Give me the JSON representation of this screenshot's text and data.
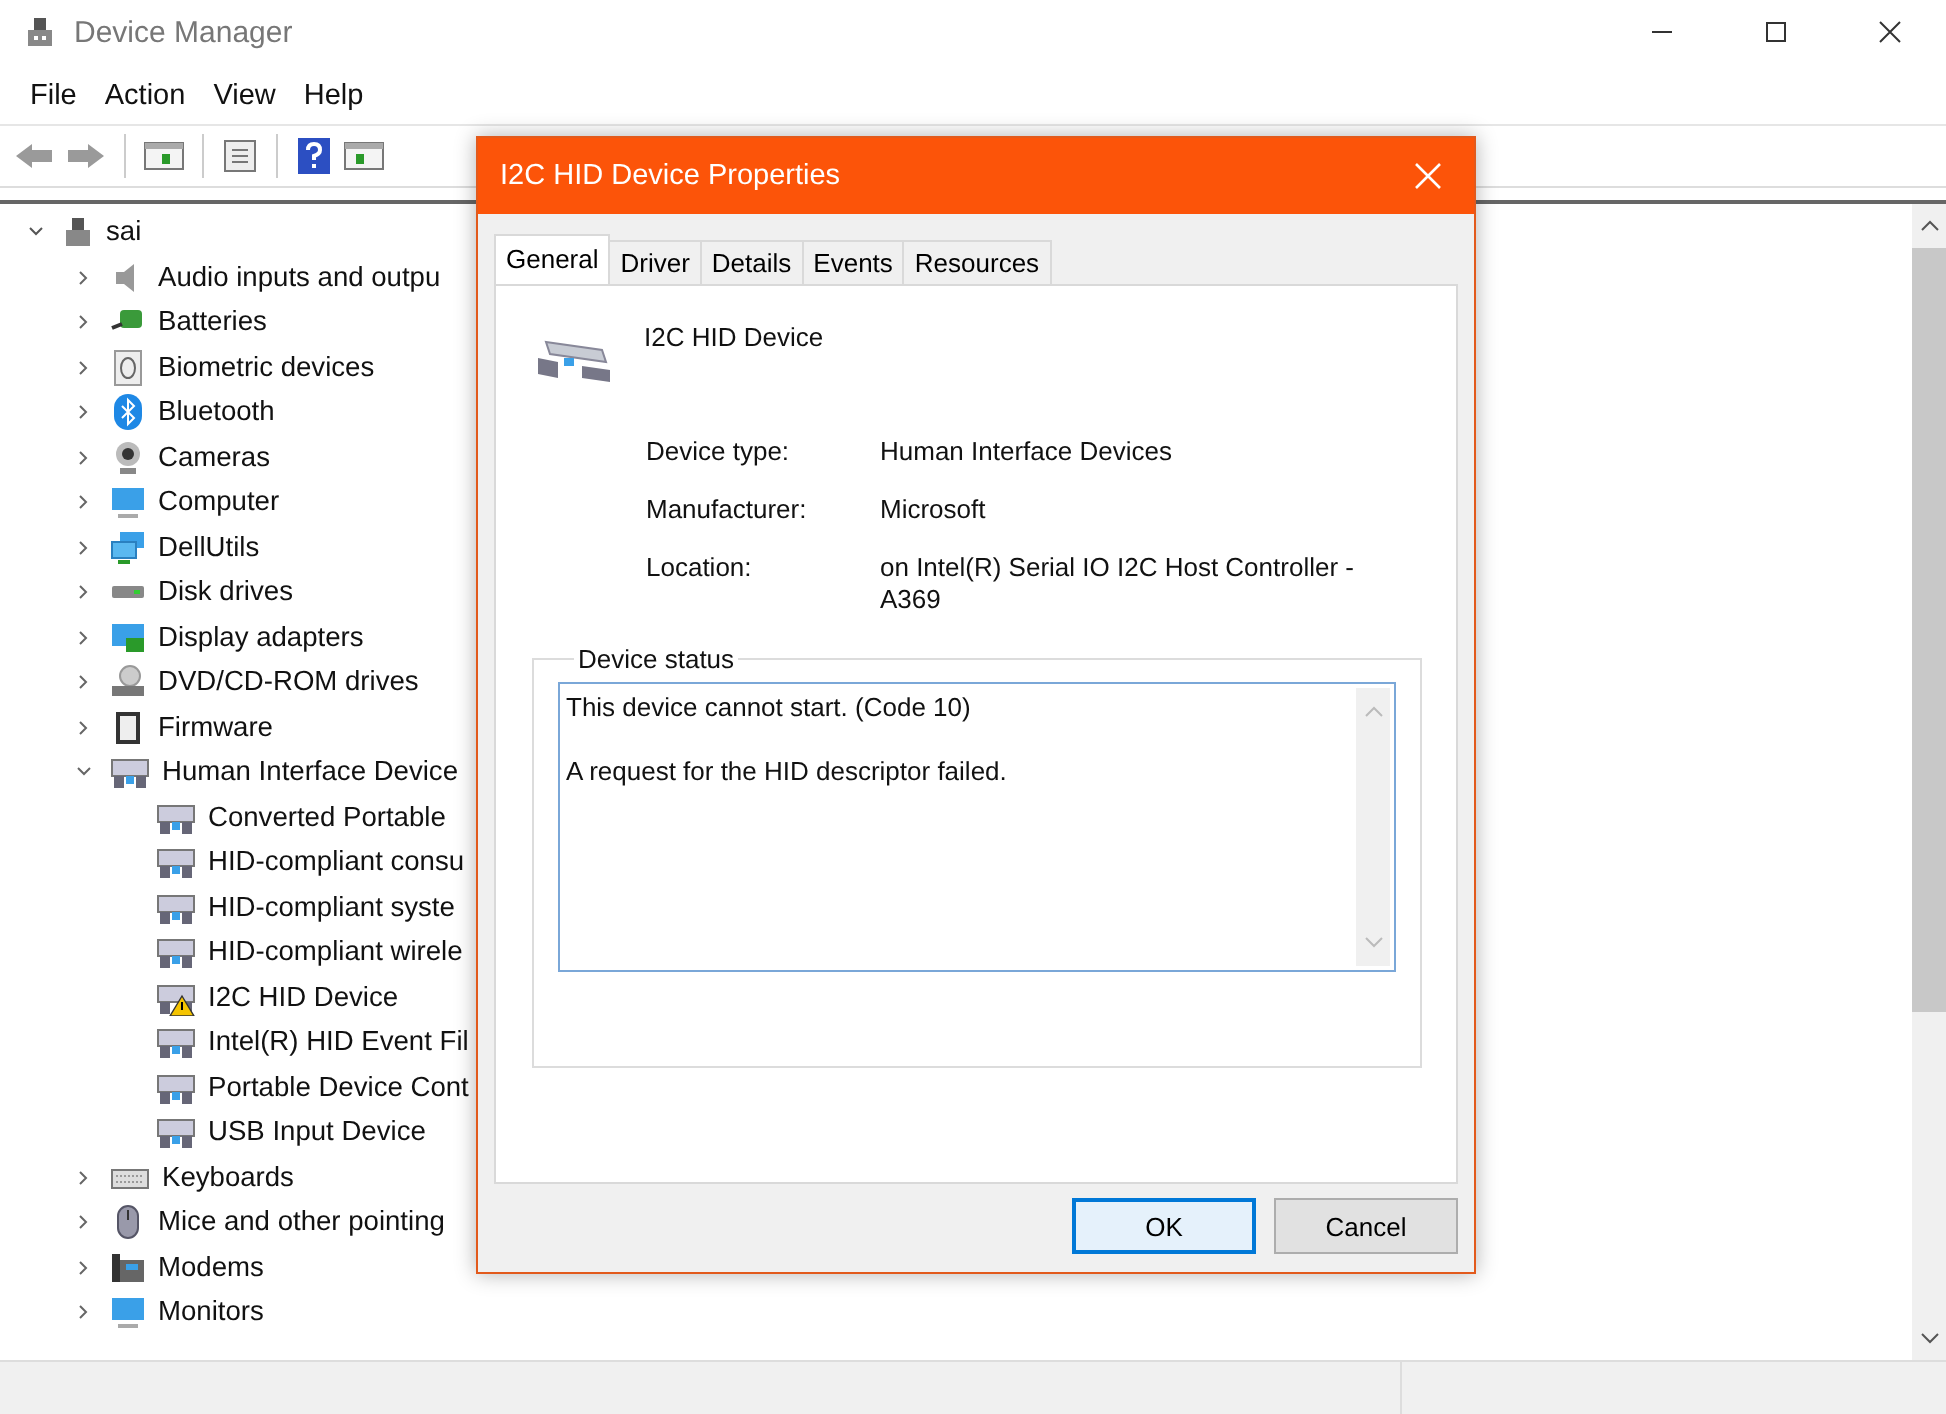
{
  "window": {
    "title": "Device Manager"
  },
  "menu": [
    "File",
    "Action",
    "View",
    "Help"
  ],
  "tree": {
    "label": "sai",
    "expanded": true,
    "children": [
      {
        "label": "Audio inputs and outpu",
        "expanded": false
      },
      {
        "label": "Batteries",
        "expanded": false
      },
      {
        "label": "Biometric devices",
        "expanded": false
      },
      {
        "label": "Bluetooth",
        "expanded": false
      },
      {
        "label": "Cameras",
        "expanded": false
      },
      {
        "label": "Computer",
        "expanded": false
      },
      {
        "label": "DellUtils",
        "expanded": false
      },
      {
        "label": "Disk drives",
        "expanded": false
      },
      {
        "label": "Display adapters",
        "expanded": false
      },
      {
        "label": "DVD/CD-ROM drives",
        "expanded": false
      },
      {
        "label": "Firmware",
        "expanded": false
      },
      {
        "label": "Human Interface Device",
        "expanded": true,
        "children": [
          {
            "label": "Converted Portable",
            "warning": false
          },
          {
            "label": "HID-compliant consu",
            "warning": false
          },
          {
            "label": "HID-compliant syste",
            "warning": false
          },
          {
            "label": "HID-compliant wirele",
            "warning": false
          },
          {
            "label": "I2C HID Device",
            "warning": true
          },
          {
            "label": "Intel(R) HID Event Fil",
            "warning": false
          },
          {
            "label": "Portable Device Cont",
            "warning": false
          },
          {
            "label": "USB Input Device",
            "warning": false
          }
        ]
      },
      {
        "label": "Keyboards",
        "expanded": false
      },
      {
        "label": "Mice and other pointing",
        "expanded": false
      },
      {
        "label": "Modems",
        "expanded": false
      },
      {
        "label": "Monitors",
        "expanded": false
      }
    ]
  },
  "dialog": {
    "title": "I2C HID Device Properties",
    "tabs": [
      {
        "label": "General",
        "selected": true
      },
      {
        "label": "Driver",
        "selected": false
      },
      {
        "label": "Details",
        "selected": false
      },
      {
        "label": "Events",
        "selected": false
      },
      {
        "label": "Resources",
        "selected": false
      }
    ],
    "device_name": "I2C HID Device",
    "properties": [
      {
        "label": "Device type:",
        "value": "Human Interface Devices"
      },
      {
        "label": "Manufacturer:",
        "value": "Microsoft"
      },
      {
        "label": "Location:",
        "value": "on Intel(R) Serial IO I2C Host Controller - A369"
      }
    ],
    "status": {
      "title": "Device status",
      "lines": [
        "This device cannot start. (Code 10)",
        "A request for the HID descriptor failed."
      ]
    },
    "buttons": [
      {
        "label": "OK",
        "default": true
      },
      {
        "label": "Cancel",
        "default": false
      }
    ]
  }
}
